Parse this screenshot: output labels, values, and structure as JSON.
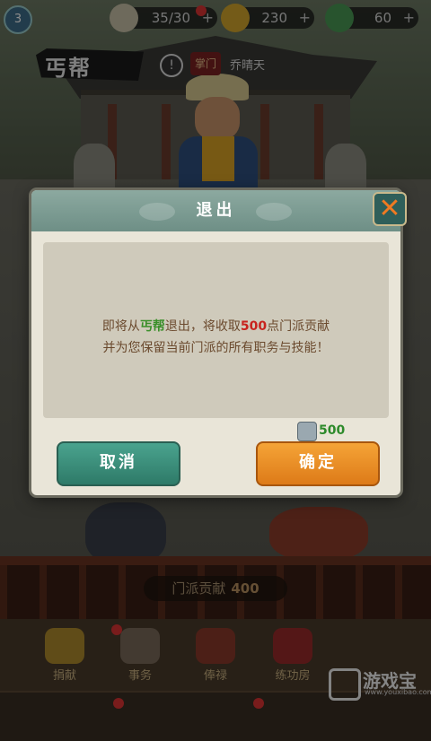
{
  "hud": {
    "level": "3",
    "stamina": "35/30",
    "coins": "230",
    "jade": "60",
    "plus": "+"
  },
  "sect": {
    "name": "丐帮",
    "info_glyph": "!",
    "master_tag": "掌门",
    "master_name": "乔晴天"
  },
  "contribution": {
    "label": "门派贡献",
    "value": "400"
  },
  "nav": [
    {
      "label": "捐献"
    },
    {
      "label": "事务"
    },
    {
      "label": "俸禄"
    },
    {
      "label": "练功房"
    }
  ],
  "dialog": {
    "title": "退出",
    "close_glyph": "✕",
    "msg_part1": "即将从",
    "sect_name": "丐帮",
    "msg_part2": "退出，将收取",
    "amount": "500",
    "msg_part3": "点门派贡献",
    "msg_line2": "并为您保留当前门派的所有职务与技能！",
    "cost_value": "500",
    "cancel_label": "取消",
    "confirm_label": "确定"
  },
  "watermark": {
    "text": "游戏宝",
    "url": "www.youxibao.com"
  },
  "colors": {
    "cancel": "#3a8f7a",
    "confirm": "#ea8d27",
    "highlight_green": "#3a8f2a",
    "highlight_red": "#c8231e"
  }
}
